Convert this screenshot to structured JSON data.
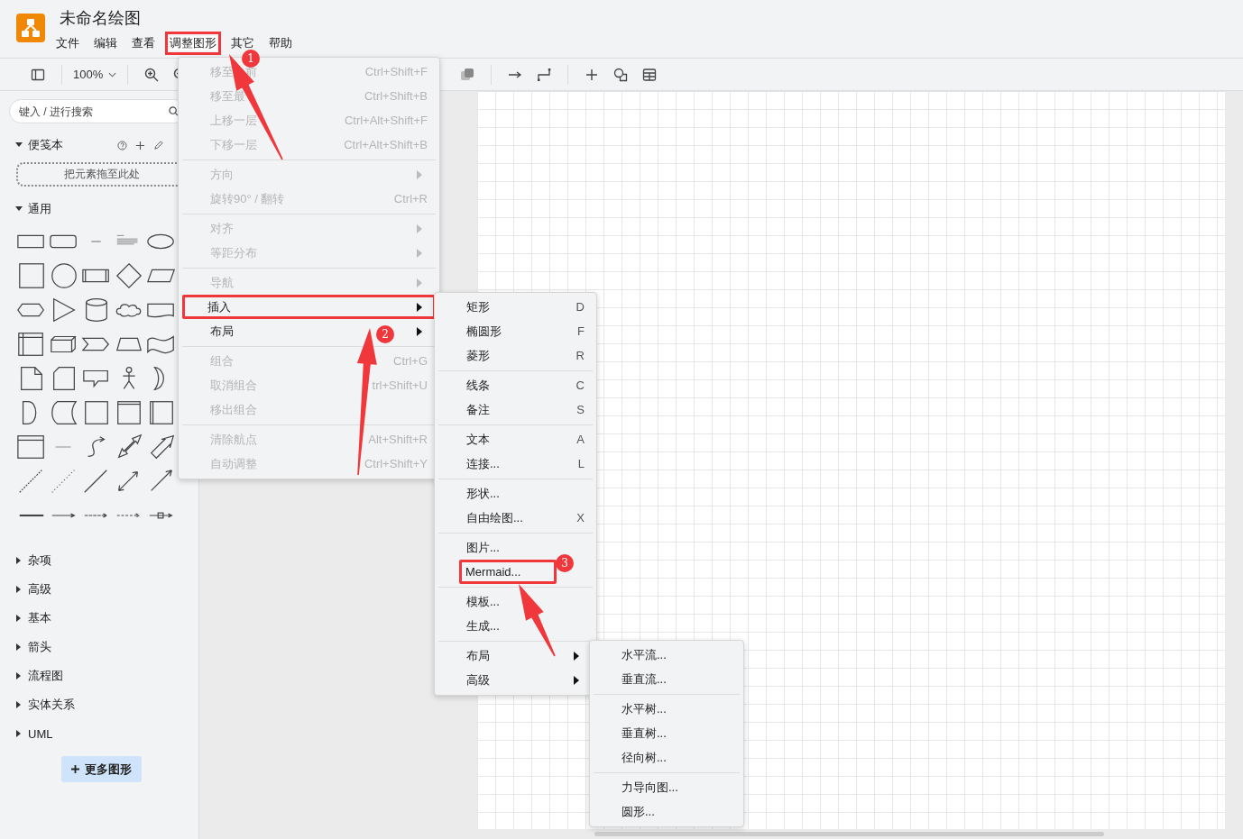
{
  "app": {
    "title": "未命名绘图"
  },
  "menubar": [
    {
      "label": "文件",
      "selected": false
    },
    {
      "label": "编辑",
      "selected": false
    },
    {
      "label": "查看",
      "selected": false
    },
    {
      "label": "调整图形",
      "selected": true
    },
    {
      "label": "其它",
      "selected": false
    },
    {
      "label": "帮助",
      "selected": false
    }
  ],
  "toolbar": {
    "zoom": "100%"
  },
  "sidebar": {
    "search": {
      "placeholder": "键入 / 进行搜索"
    },
    "scratchpad": {
      "title": "便笺本",
      "expanded": true,
      "drop_hint": "把元素拖至此处"
    },
    "sections": [
      {
        "title": "通用",
        "expanded": true
      },
      {
        "title": "杂项",
        "expanded": false
      },
      {
        "title": "高级",
        "expanded": false
      },
      {
        "title": "基本",
        "expanded": false
      },
      {
        "title": "箭头",
        "expanded": false
      },
      {
        "title": "流程图",
        "expanded": false
      },
      {
        "title": "实体关系",
        "expanded": false
      },
      {
        "title": "UML",
        "expanded": false
      }
    ],
    "more_button": "更多图形"
  },
  "menus": [
    {
      "items": [
        {
          "kind": "item",
          "label": "移至",
          "label_after": "前",
          "shortcut": "Ctrl+Shift+F",
          "disabled": true,
          "submenu": false,
          "boxed": false
        },
        {
          "kind": "item",
          "label": "移至最",
          "shortcut": "Ctrl+Shift+B",
          "disabled": true,
          "submenu": false,
          "boxed": false
        },
        {
          "kind": "item",
          "label": "上移一层",
          "shortcut": "Ctrl+Alt+Shift+F",
          "disabled": true,
          "submenu": false,
          "boxed": false
        },
        {
          "kind": "item",
          "label": "下移一层",
          "shortcut": "Ctrl+Alt+Shift+B",
          "disabled": true,
          "submenu": false,
          "boxed": false
        },
        {
          "kind": "separator"
        },
        {
          "kind": "item",
          "label": "方向",
          "disabled": true,
          "submenu": true,
          "boxed": false
        },
        {
          "kind": "item",
          "label": "旋转90° / 翻转",
          "shortcut": "Ctrl+R",
          "disabled": true,
          "submenu": false,
          "boxed": false
        },
        {
          "kind": "separator"
        },
        {
          "kind": "item",
          "label": "对齐",
          "disabled": true,
          "submenu": true,
          "boxed": false
        },
        {
          "kind": "item",
          "label": "等距分布",
          "disabled": true,
          "submenu": true,
          "boxed": false
        },
        {
          "kind": "separator"
        },
        {
          "kind": "item",
          "label": "导航",
          "disabled": true,
          "submenu": true,
          "boxed": false
        },
        {
          "kind": "item",
          "label": "插入",
          "disabled": false,
          "submenu": true,
          "boxed": true
        },
        {
          "kind": "item",
          "label": "布局",
          "disabled": false,
          "submenu": true,
          "boxed": false
        },
        {
          "kind": "separator"
        },
        {
          "kind": "item",
          "label": "组合",
          "shortcut": "Ctrl+G",
          "disabled": true,
          "submenu": false,
          "boxed": false
        },
        {
          "kind": "item",
          "label": "取消组合",
          "shortcut": "trl+Shift+U",
          "disabled": true,
          "submenu": false,
          "boxed": false
        },
        {
          "kind": "item",
          "label": "移出组合",
          "disabled": true,
          "submenu": false,
          "boxed": false
        },
        {
          "kind": "separator"
        },
        {
          "kind": "item",
          "label": "清除航点",
          "shortcut": "Alt+Shift+R",
          "disabled": true,
          "submenu": false,
          "boxed": false
        },
        {
          "kind": "item",
          "label": "自动调整",
          "shortcut": "Ctrl+Shift+Y",
          "disabled": true,
          "submenu": false,
          "boxed": false
        }
      ]
    },
    {
      "items": [
        {
          "kind": "item",
          "label": "矩形",
          "shortcut": "D",
          "disabled": false,
          "submenu": false,
          "boxed": false
        },
        {
          "kind": "item",
          "label": "椭圆形",
          "shortcut": "F",
          "disabled": false,
          "submenu": false,
          "boxed": false
        },
        {
          "kind": "item",
          "label": "菱形",
          "shortcut": "R",
          "disabled": false,
          "submenu": false,
          "boxed": false
        },
        {
          "kind": "separator"
        },
        {
          "kind": "item",
          "label": "线条",
          "shortcut": "C",
          "disabled": false,
          "submenu": false,
          "boxed": false
        },
        {
          "kind": "item",
          "label": "备注",
          "shortcut": "S",
          "disabled": false,
          "submenu": false,
          "boxed": false
        },
        {
          "kind": "separator"
        },
        {
          "kind": "item",
          "label": "文本",
          "shortcut": "A",
          "disabled": false,
          "submenu": false,
          "boxed": false
        },
        {
          "kind": "item",
          "label": "连接...",
          "shortcut": "L",
          "disabled": false,
          "submenu": false,
          "boxed": false
        },
        {
          "kind": "separator"
        },
        {
          "kind": "item",
          "label": "形状...",
          "disabled": false,
          "submenu": false,
          "boxed": false
        },
        {
          "kind": "item",
          "label": "自由绘图...",
          "shortcut": "X",
          "disabled": false,
          "submenu": false,
          "boxed": false
        },
        {
          "kind": "separator"
        },
        {
          "kind": "item",
          "label": "图片...",
          "disabled": false,
          "submenu": false,
          "boxed": false
        },
        {
          "kind": "item",
          "label": "Mermaid...",
          "disabled": false,
          "submenu": false,
          "boxed": true
        },
        {
          "kind": "separator"
        },
        {
          "kind": "item",
          "label": "模板...",
          "disabled": false,
          "submenu": false,
          "boxed": false
        },
        {
          "kind": "item",
          "label": "生成...",
          "disabled": false,
          "submenu": false,
          "boxed": false
        },
        {
          "kind": "separator"
        },
        {
          "kind": "item",
          "label": "布局",
          "disabled": false,
          "submenu": true,
          "boxed": false
        },
        {
          "kind": "item",
          "label": "高级",
          "disabled": false,
          "submenu": true,
          "boxed": false
        }
      ]
    },
    {
      "items": [
        {
          "kind": "item",
          "label": "水平流...",
          "disabled": false,
          "submenu": false,
          "boxed": false
        },
        {
          "kind": "item",
          "label": "垂直流...",
          "disabled": false,
          "submenu": false,
          "boxed": false
        },
        {
          "kind": "separator"
        },
        {
          "kind": "item",
          "label": "水平树...",
          "disabled": false,
          "submenu": false,
          "boxed": false
        },
        {
          "kind": "item",
          "label": "垂直树...",
          "disabled": false,
          "submenu": false,
          "boxed": false
        },
        {
          "kind": "item",
          "label": "径向树...",
          "disabled": false,
          "submenu": false,
          "boxed": false
        },
        {
          "kind": "separator"
        },
        {
          "kind": "item",
          "label": "力导向图...",
          "disabled": false,
          "submenu": false,
          "boxed": false
        },
        {
          "kind": "item",
          "label": "圆形...",
          "disabled": false,
          "submenu": false,
          "boxed": false
        }
      ]
    }
  ],
  "annotations": [
    {
      "number": "1"
    },
    {
      "number": "2"
    },
    {
      "number": "3"
    }
  ]
}
